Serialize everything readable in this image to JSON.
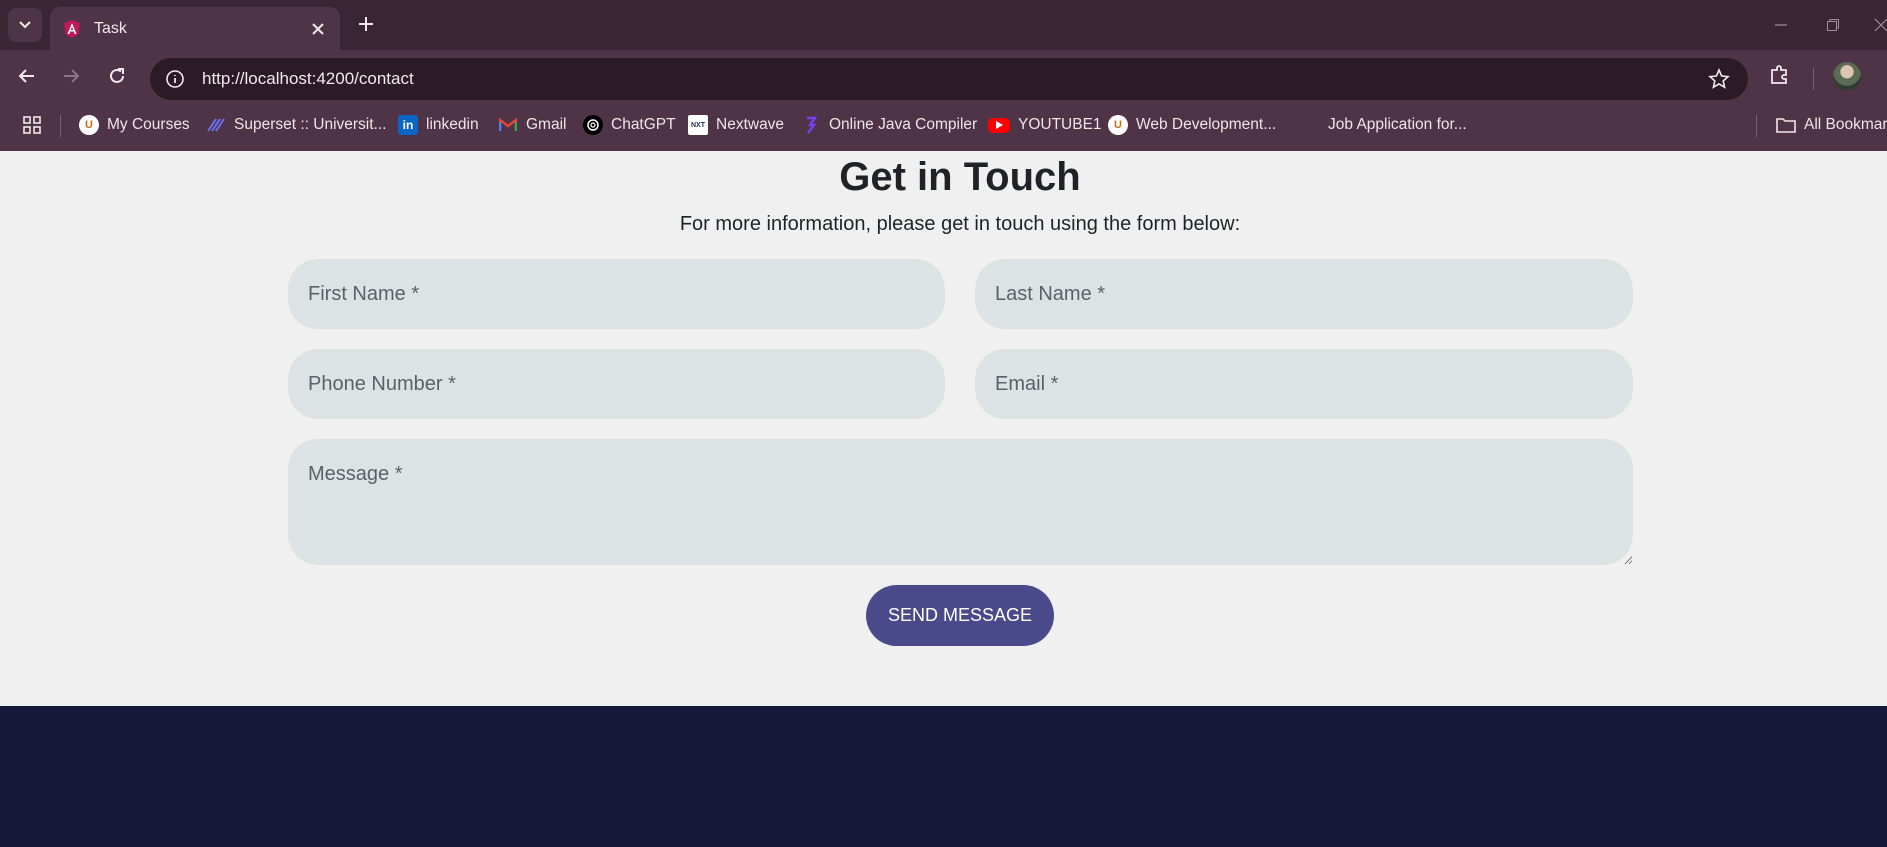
{
  "browser": {
    "tab": {
      "title": "Task"
    },
    "url": "http://localhost:4200/contact",
    "bookmarks": [
      {
        "label": "My Courses",
        "icon": "university-logo-icon"
      },
      {
        "label": "Superset :: Universit...",
        "icon": "superset-icon"
      },
      {
        "label": "linkedin",
        "icon": "linkedin-icon"
      },
      {
        "label": "Gmail",
        "icon": "gmail-icon"
      },
      {
        "label": "ChatGPT",
        "icon": "chatgpt-icon"
      },
      {
        "label": "Nextwave",
        "icon": "nextwave-icon"
      },
      {
        "label": "Online Java Compiler",
        "icon": "compiler-icon"
      },
      {
        "label": "YOUTUBE1",
        "icon": "youtube-icon"
      },
      {
        "label": "Web Development...",
        "icon": "university-logo-icon"
      },
      {
        "label": "Job Application for...",
        "icon": "none"
      }
    ],
    "all_bookmarks": "All Bookmarks"
  },
  "page": {
    "heading": "Get in Touch",
    "subtext": "For more information, please get in touch using the form below:",
    "form": {
      "first_name_placeholder": "First Name *",
      "last_name_placeholder": "Last Name *",
      "phone_placeholder": "Phone Number *",
      "email_placeholder": "Email *",
      "message_placeholder": "Message *",
      "submit_label": "SEND MESSAGE"
    }
  },
  "colors": {
    "chrome_bg": "#3a2534",
    "toolbar_bg": "#4e3446",
    "page_bg": "#f0f0f0",
    "field_bg": "#dce3e5",
    "button_bg": "#4a4a8b",
    "footer_bg": "#161838"
  }
}
